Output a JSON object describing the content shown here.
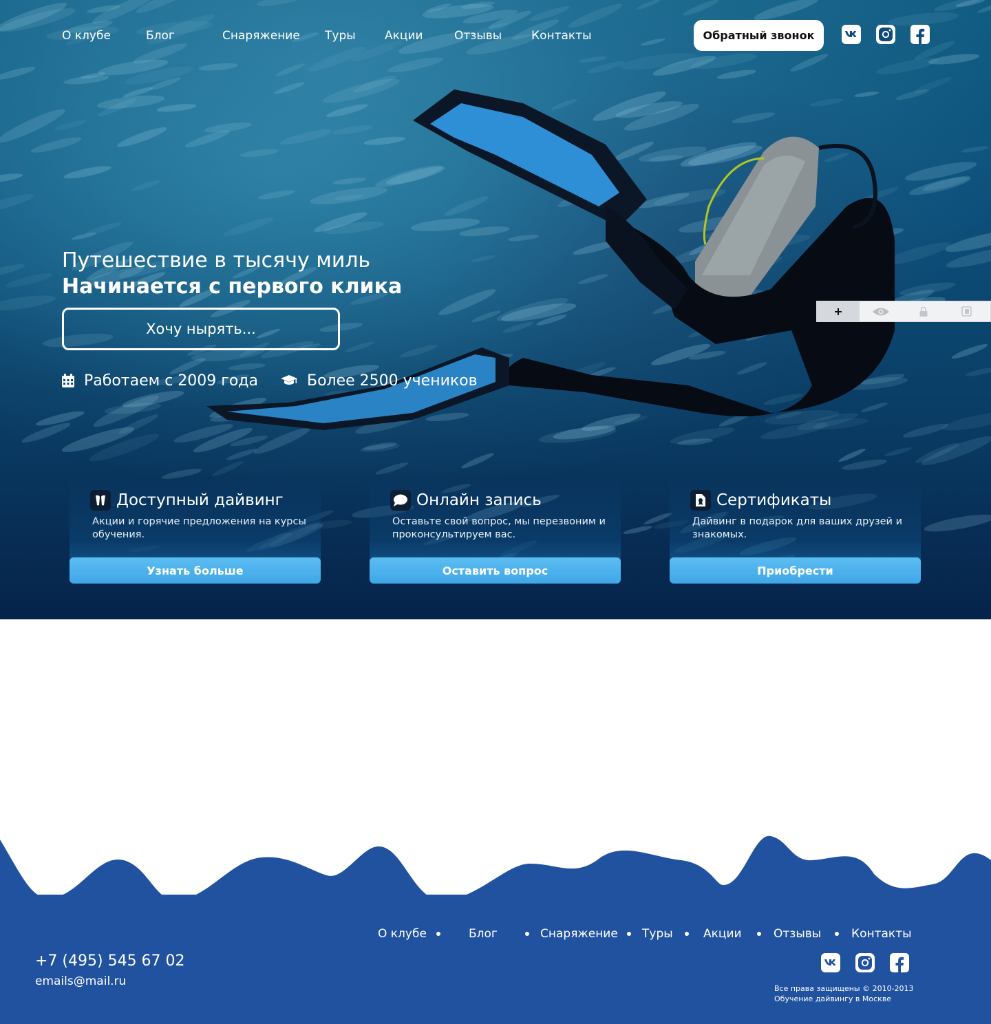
{
  "header": {
    "nav": [
      {
        "label": "О клубе"
      },
      {
        "label": "Блог"
      },
      {
        "label": "Снаряжение"
      },
      {
        "label": "Туры"
      },
      {
        "label": "Акции"
      },
      {
        "label": "Отзывы"
      },
      {
        "label": "Контакты"
      }
    ],
    "callback_label": "Обратный звонок",
    "social": [
      "vk-icon",
      "instagram-icon",
      "facebook-icon"
    ]
  },
  "hero": {
    "title_line1": "Путешествие в тысячу миль",
    "title_line2": "Начинается с первого клика",
    "cta_label": "Хочу нырять...",
    "facts": [
      {
        "icon": "calendar-icon",
        "text": "Работаем с 2009 года"
      },
      {
        "icon": "graduation-cap-icon",
        "text": "Более 2500 учеников"
      }
    ]
  },
  "cards": [
    {
      "icon": "flippers-icon",
      "title": "Доступный дайвинг",
      "text": "Акции и горячие предложения на курсы обучения.",
      "button": "Узнать больше"
    },
    {
      "icon": "chat-bubble-icon",
      "title": "Онлайн запись",
      "text": "Оставьте свой вопрос, мы перезвоним и проконсультируем вас.",
      "button": "Оставить вопрос"
    },
    {
      "icon": "certificate-icon",
      "title": "Сертификаты",
      "text": "Дайвинг в подарок для ваших друзей и знакомых.",
      "button": "Приобрести"
    }
  ],
  "toolbar": {
    "tools": [
      "plus-icon",
      "eye-icon",
      "lock-icon",
      "copy-icon"
    ]
  },
  "footer": {
    "nav": [
      {
        "label": "О клубе"
      },
      {
        "label": "Блог"
      },
      {
        "label": "Снаряжение"
      },
      {
        "label": "Туры"
      },
      {
        "label": "Акции"
      },
      {
        "label": "Отзывы"
      },
      {
        "label": "Контакты"
      }
    ],
    "phone": "+7 (495) 545 67 02",
    "email": "emails@mail.ru",
    "copyright_line1": "Все права защищены © 2010-2013",
    "copyright_line2": "Обучение дайвингу в Москве",
    "social": [
      "vk-icon",
      "instagram-icon",
      "facebook-icon"
    ]
  },
  "colors": {
    "footer_blue": "#2052a0",
    "card_button": "#4fb2ee",
    "hero_deep": "#06234a"
  }
}
